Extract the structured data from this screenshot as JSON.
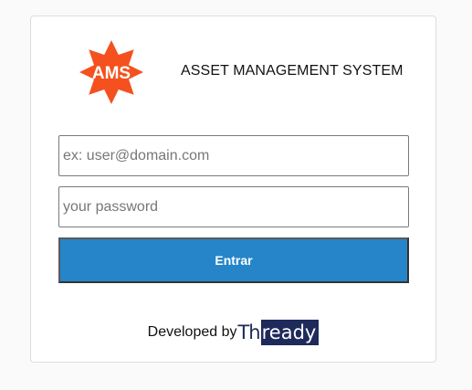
{
  "logo": {
    "text": "AMS",
    "color": "#f4511e"
  },
  "header": {
    "title": "ASSET MANAGEMENT SYSTEM"
  },
  "login": {
    "email_placeholder": "ex: user@domain.com",
    "email_value": "",
    "password_placeholder": "your password",
    "password_value": "",
    "submit_label": "Entrar",
    "submit_color": "#2585c8"
  },
  "footer": {
    "developed_by": "Developed by",
    "brand_part1": "Th",
    "brand_part2": "ready",
    "brand_color": "#1e2a5a"
  }
}
